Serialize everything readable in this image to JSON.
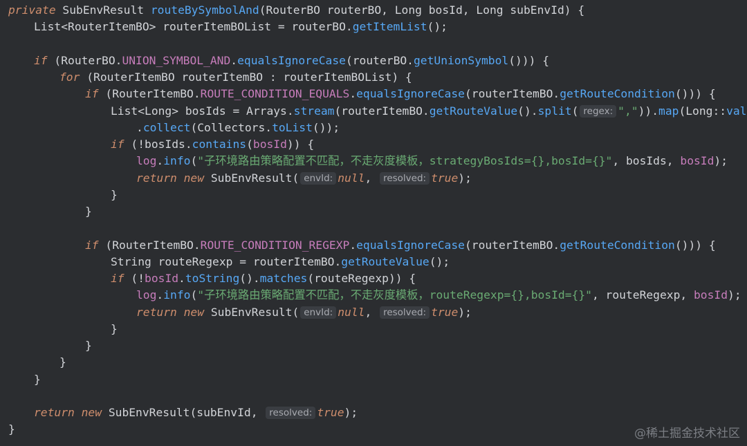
{
  "colors": {
    "background": "#2b2d30",
    "keyword": "#cf8e6d",
    "function": "#57a8f5",
    "constant": "#c77dbb",
    "string": "#6aab73",
    "text": "#d2d4d8",
    "hint_bg": "#3a3d42"
  },
  "watermark": "@稀土掘金技术社区",
  "lines": [
    {
      "indent": 0,
      "tokens": [
        {
          "t": "private ",
          "c": "kw"
        },
        {
          "t": "SubEnvResult ",
          "c": "typ"
        },
        {
          "t": "routeBySymbolAnd",
          "c": "fn"
        },
        {
          "t": "(RouterBO routerBO, Long bosId, Long subEnvId) {",
          "c": "typ"
        }
      ]
    },
    {
      "indent": 1,
      "tokens": [
        {
          "t": "List<RouterItemBO> routerItemBOList = routerBO.",
          "c": "typ"
        },
        {
          "t": "getItemList",
          "c": "fn"
        },
        {
          "t": "();",
          "c": "typ"
        }
      ]
    },
    {
      "indent": 0,
      "tokens": []
    },
    {
      "indent": 1,
      "tokens": [
        {
          "t": "if ",
          "c": "kw"
        },
        {
          "t": "(RouterBO.",
          "c": "typ"
        },
        {
          "t": "UNION_SYMBOL_AND",
          "c": "cst"
        },
        {
          "t": ".",
          "c": "typ"
        },
        {
          "t": "equalsIgnoreCase",
          "c": "fn"
        },
        {
          "t": "(routerBO.",
          "c": "typ"
        },
        {
          "t": "getUnionSymbol",
          "c": "fn"
        },
        {
          "t": "())) {",
          "c": "typ"
        }
      ]
    },
    {
      "indent": 2,
      "tokens": [
        {
          "t": "for ",
          "c": "kw"
        },
        {
          "t": "(RouterItemBO routerItemBO : routerItemBOList) {",
          "c": "typ"
        }
      ]
    },
    {
      "indent": 3,
      "tokens": [
        {
          "t": "if ",
          "c": "kw"
        },
        {
          "t": "(RouterItemBO.",
          "c": "typ"
        },
        {
          "t": "ROUTE_CONDITION_EQUALS",
          "c": "cst"
        },
        {
          "t": ".",
          "c": "typ"
        },
        {
          "t": "equalsIgnoreCase",
          "c": "fn"
        },
        {
          "t": "(routerItemBO.",
          "c": "typ"
        },
        {
          "t": "getRouteCondition",
          "c": "fn"
        },
        {
          "t": "())) {",
          "c": "typ"
        }
      ]
    },
    {
      "indent": 4,
      "tokens": [
        {
          "t": "List<Long> bosIds = Arrays.",
          "c": "typ"
        },
        {
          "t": "stream",
          "c": "fn"
        },
        {
          "t": "(routerItemBO.",
          "c": "typ"
        },
        {
          "t": "getRouteValue",
          "c": "fn"
        },
        {
          "t": "().",
          "c": "typ"
        },
        {
          "t": "split",
          "c": "fn"
        },
        {
          "t": "(",
          "c": "typ"
        },
        {
          "t": "regex:",
          "c": "hint"
        },
        {
          "t": "\",\"",
          "c": "str"
        },
        {
          "t": ")).",
          "c": "typ"
        },
        {
          "t": "map",
          "c": "fn"
        },
        {
          "t": "(Long::",
          "c": "typ"
        },
        {
          "t": "valueOf",
          "c": "fn"
        },
        {
          "t": ")",
          "c": "typ"
        }
      ]
    },
    {
      "indent": 5,
      "tokens": [
        {
          "t": ".",
          "c": "typ"
        },
        {
          "t": "collect",
          "c": "fn"
        },
        {
          "t": "(Collectors.",
          "c": "typ"
        },
        {
          "t": "toList",
          "c": "fn"
        },
        {
          "t": "());",
          "c": "typ"
        }
      ]
    },
    {
      "indent": 4,
      "tokens": [
        {
          "t": "if ",
          "c": "kw"
        },
        {
          "t": "(!bosIds.",
          "c": "typ"
        },
        {
          "t": "contains",
          "c": "fn"
        },
        {
          "t": "(",
          "c": "typ"
        },
        {
          "t": "bosId",
          "c": "fld"
        },
        {
          "t": ")) {",
          "c": "typ"
        }
      ]
    },
    {
      "indent": 5,
      "tokens": [
        {
          "t": "log",
          "c": "lg"
        },
        {
          "t": ".",
          "c": "typ"
        },
        {
          "t": "info",
          "c": "fn"
        },
        {
          "t": "(",
          "c": "typ"
        },
        {
          "t": "\"子环境路由策略配置不匹配，不走灰度模板，strategyBosIds={},bosId={}\"",
          "c": "str"
        },
        {
          "t": ", bosIds, ",
          "c": "typ"
        },
        {
          "t": "bosId",
          "c": "fld"
        },
        {
          "t": ");",
          "c": "typ"
        }
      ]
    },
    {
      "indent": 5,
      "tokens": [
        {
          "t": "return ",
          "c": "kw"
        },
        {
          "t": "new ",
          "c": "kw"
        },
        {
          "t": "SubEnvResult(",
          "c": "typ"
        },
        {
          "t": "envId:",
          "c": "hint"
        },
        {
          "t": "null",
          "c": "lit"
        },
        {
          "t": ", ",
          "c": "typ"
        },
        {
          "t": "resolved:",
          "c": "hint"
        },
        {
          "t": "true",
          "c": "lit"
        },
        {
          "t": ");",
          "c": "typ"
        }
      ]
    },
    {
      "indent": 4,
      "tokens": [
        {
          "t": "}",
          "c": "typ"
        }
      ]
    },
    {
      "indent": 3,
      "tokens": [
        {
          "t": "}",
          "c": "typ"
        }
      ]
    },
    {
      "indent": 0,
      "tokens": []
    },
    {
      "indent": 3,
      "tokens": [
        {
          "t": "if ",
          "c": "kw"
        },
        {
          "t": "(RouterItemBO.",
          "c": "typ"
        },
        {
          "t": "ROUTE_CONDITION_REGEXP",
          "c": "cst"
        },
        {
          "t": ".",
          "c": "typ"
        },
        {
          "t": "equalsIgnoreCase",
          "c": "fn"
        },
        {
          "t": "(routerItemBO.",
          "c": "typ"
        },
        {
          "t": "getRouteCondition",
          "c": "fn"
        },
        {
          "t": "())) {",
          "c": "typ"
        }
      ]
    },
    {
      "indent": 4,
      "tokens": [
        {
          "t": "String routeRegexp = routerItemBO.",
          "c": "typ"
        },
        {
          "t": "getRouteValue",
          "c": "fn"
        },
        {
          "t": "();",
          "c": "typ"
        }
      ]
    },
    {
      "indent": 4,
      "tokens": [
        {
          "t": "if ",
          "c": "kw"
        },
        {
          "t": "(!",
          "c": "typ"
        },
        {
          "t": "bosId",
          "c": "fld"
        },
        {
          "t": ".",
          "c": "typ"
        },
        {
          "t": "toString",
          "c": "fn"
        },
        {
          "t": "().",
          "c": "typ"
        },
        {
          "t": "matches",
          "c": "fn"
        },
        {
          "t": "(routeRegexp)) {",
          "c": "typ"
        }
      ]
    },
    {
      "indent": 5,
      "tokens": [
        {
          "t": "log",
          "c": "lg"
        },
        {
          "t": ".",
          "c": "typ"
        },
        {
          "t": "info",
          "c": "fn"
        },
        {
          "t": "(",
          "c": "typ"
        },
        {
          "t": "\"子环境路由策略配置不匹配，不走灰度模板，routeRegexp={},bosId={}\"",
          "c": "str"
        },
        {
          "t": ", routeRegexp, ",
          "c": "typ"
        },
        {
          "t": "bosId",
          "c": "fld"
        },
        {
          "t": ");",
          "c": "typ"
        }
      ]
    },
    {
      "indent": 5,
      "tokens": [
        {
          "t": "return ",
          "c": "kw"
        },
        {
          "t": "new ",
          "c": "kw"
        },
        {
          "t": "SubEnvResult(",
          "c": "typ"
        },
        {
          "t": "envId:",
          "c": "hint"
        },
        {
          "t": "null",
          "c": "lit"
        },
        {
          "t": ", ",
          "c": "typ"
        },
        {
          "t": "resolved:",
          "c": "hint"
        },
        {
          "t": "true",
          "c": "lit"
        },
        {
          "t": ");",
          "c": "typ"
        }
      ]
    },
    {
      "indent": 4,
      "tokens": [
        {
          "t": "}",
          "c": "typ"
        }
      ]
    },
    {
      "indent": 3,
      "tokens": [
        {
          "t": "}",
          "c": "typ"
        }
      ]
    },
    {
      "indent": 2,
      "tokens": [
        {
          "t": "}",
          "c": "typ"
        }
      ]
    },
    {
      "indent": 1,
      "tokens": [
        {
          "t": "}",
          "c": "typ"
        }
      ]
    },
    {
      "indent": 0,
      "tokens": []
    },
    {
      "indent": 1,
      "tokens": [
        {
          "t": "return ",
          "c": "kw"
        },
        {
          "t": "new ",
          "c": "kw"
        },
        {
          "t": "SubEnvResult(subEnvId, ",
          "c": "typ"
        },
        {
          "t": "resolved:",
          "c": "hint"
        },
        {
          "t": "true",
          "c": "lit"
        },
        {
          "t": ");",
          "c": "typ"
        }
      ]
    },
    {
      "indent": 0,
      "tokens": [
        {
          "t": "}",
          "c": "typ"
        }
      ]
    }
  ]
}
